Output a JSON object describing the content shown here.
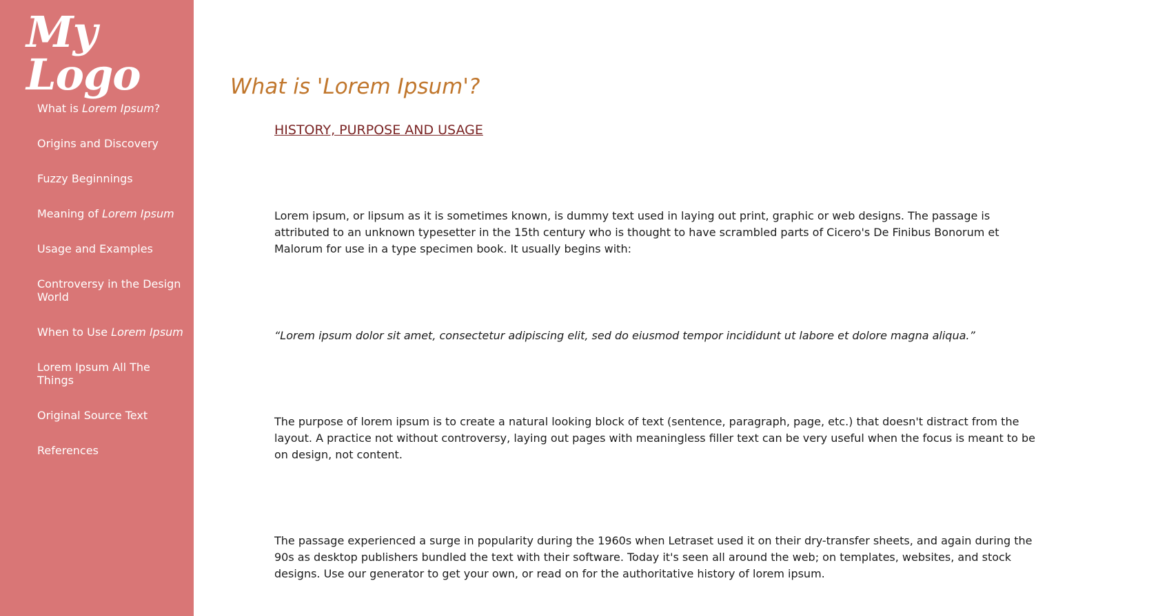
{
  "sidebar": {
    "logo": "My Logo",
    "items": [
      {
        "pre": "What is ",
        "em": "Lorem Ipsum",
        "post": "?"
      },
      {
        "pre": "Origins and Discovery",
        "em": "",
        "post": ""
      },
      {
        "pre": "Fuzzy Beginnings",
        "em": "",
        "post": ""
      },
      {
        "pre": "Meaning of ",
        "em": "Lorem Ipsum",
        "post": ""
      },
      {
        "pre": "Usage and Examples",
        "em": "",
        "post": ""
      },
      {
        "pre": "Controversy in the Design World",
        "em": "",
        "post": ""
      },
      {
        "pre": "When to Use ",
        "em": "Lorem Ipsum",
        "post": ""
      },
      {
        "pre": "Lorem Ipsum All The Things",
        "em": "",
        "post": ""
      },
      {
        "pre": "Original Source Text",
        "em": "",
        "post": ""
      },
      {
        "pre": "References",
        "em": "",
        "post": ""
      }
    ]
  },
  "main": {
    "title": "What is 'Lorem Ipsum'?",
    "subtitle": "HISTORY, PURPOSE AND USAGE",
    "paragraph_1": "Lorem ipsum, or lipsum as it is sometimes known, is dummy text used in laying out print, graphic or web designs. The passage is attributed to an unknown typesetter in the 15th century who is thought to have scrambled parts of Cicero's De Finibus Bonorum et Malorum for use in a type specimen book. It usually begins with:",
    "quote": "“Lorem ipsum dolor sit amet, consectetur adipiscing elit, sed do eiusmod tempor incididunt ut labore et dolore magna aliqua.”",
    "paragraph_2": "The purpose of lorem ipsum is to create a natural looking block of text (sentence, paragraph, page, etc.) that doesn't distract from the layout. A practice not without controversy, laying out pages with meaningless filler text can be very useful when the focus is meant to be on design, not content.",
    "paragraph_3": "The passage experienced a surge in popularity during the 1960s when Letraset used it on their dry-transfer sheets, and again during the 90s as desktop publishers bundled the text with their software. Today it's seen all around the web; on templates, websites, and stock designs. Use our generator to get your own, or read on for the authoritative history of lorem ipsum."
  },
  "colors": {
    "sidebar_bg": "#d97676",
    "title": "#c0762c",
    "subtitle": "#7a2424",
    "body_text": "#1a1a1a"
  }
}
